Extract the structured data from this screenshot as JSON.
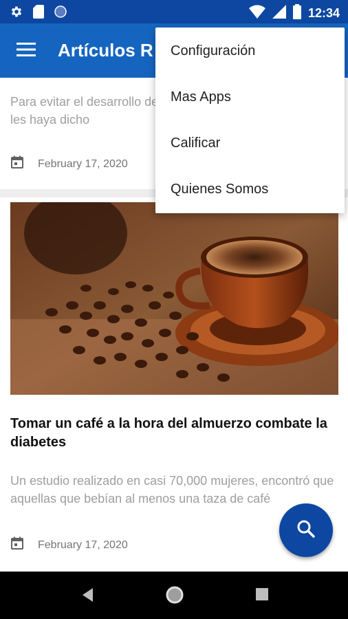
{
  "status_bar": {
    "time": "12:34",
    "icons": [
      "gear-icon",
      "sim-card-icon",
      "circle-icon",
      "wifi-icon",
      "signal-icon",
      "battery-icon"
    ]
  },
  "app_bar": {
    "title": "Artículos R",
    "menu_icon": "hamburger-menu-icon"
  },
  "overflow_menu": {
    "items": [
      {
        "label": "Configuración"
      },
      {
        "label": "Mas Apps"
      },
      {
        "label": "Calificar"
      },
      {
        "label": "Quienes Somos"
      }
    ]
  },
  "articles": [
    {
      "excerpt": "Para evitar el desarrollo de la diabetes es posible que se les haya dicho",
      "date": "February 17, 2020"
    },
    {
      "image": "coffee-cup-and-beans",
      "title": "Tomar un café a la hora del almuerzo combate la diabetes",
      "excerpt": "Un estudio realizado en casi 70,000 mujeres, encontró que aquellas que bebían al menos una taza de café",
      "date": "February 17, 2020"
    }
  ],
  "fab": {
    "icon": "search-icon"
  },
  "nav_bar": {
    "icons": [
      "back-icon",
      "home-icon",
      "recents-icon"
    ]
  },
  "colors": {
    "status_bar": "#0d47a1",
    "app_bar": "#1565c0",
    "fab": "#0d47a1",
    "excerpt_text": "#9e9e9e"
  }
}
